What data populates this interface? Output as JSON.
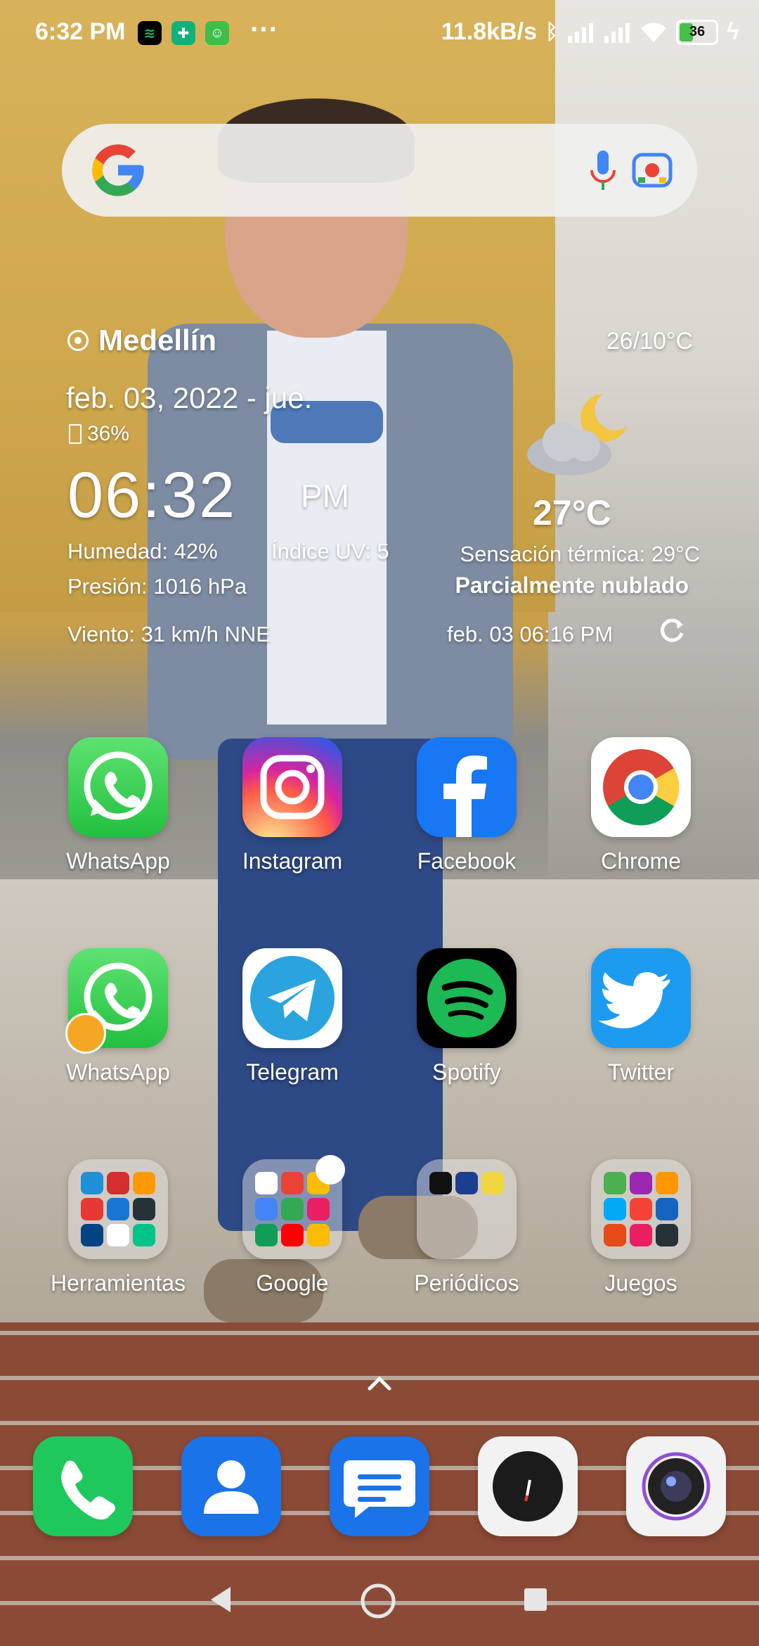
{
  "status_bar": {
    "time": "6:32 PM",
    "notif_icons": [
      "spotify-icon",
      "shield-icon",
      "android-icon"
    ],
    "more": "···",
    "net_speed": "11.8kB/s",
    "battery": "36"
  },
  "search_bar": {
    "placeholder": ""
  },
  "weather": {
    "city": "Medellín",
    "range": "26/10°C",
    "date": "feb. 03, 2022 - jue.",
    "battery": "36%",
    "clock": "06:32",
    "ampm": "PM",
    "humidity": "Humedad: 42%",
    "uv": "Índice UV: 5",
    "pressure": "Presión: 1016 hPa",
    "wind": "Viento: 31 km/h NNE",
    "temp": "27°C",
    "feels": "Sensación térmica: 29°C",
    "condition": "Parcialmente nublado",
    "updated": "feb. 03  06:16 PM"
  },
  "apps_row1": [
    {
      "label": "WhatsApp",
      "icon": "whatsapp-icon"
    },
    {
      "label": "Instagram",
      "icon": "instagram-icon"
    },
    {
      "label": "Facebook",
      "icon": "facebook-icon"
    },
    {
      "label": "Chrome",
      "icon": "chrome-icon"
    }
  ],
  "apps_row2": [
    {
      "label": "WhatsApp",
      "icon": "whatsapp-dual-icon"
    },
    {
      "label": "Telegram",
      "icon": "telegram-icon"
    },
    {
      "label": "Spotify",
      "icon": "spotify-icon"
    },
    {
      "label": "Twitter",
      "icon": "twitter-icon"
    }
  ],
  "folders": [
    {
      "label": "Herramientas"
    },
    {
      "label": "Google"
    },
    {
      "label": "Periódicos"
    },
    {
      "label": "Juegos"
    }
  ],
  "dock": [
    {
      "name": "phone-icon"
    },
    {
      "name": "contacts-icon"
    },
    {
      "name": "messages-icon"
    },
    {
      "name": "compass-icon"
    },
    {
      "name": "camera-icon"
    }
  ],
  "colors": {
    "whatsapp": "#25d366",
    "facebook": "#1877f2",
    "telegram": "#2aa3df",
    "spotify": "#1db954",
    "twitter": "#1d9bf0"
  }
}
